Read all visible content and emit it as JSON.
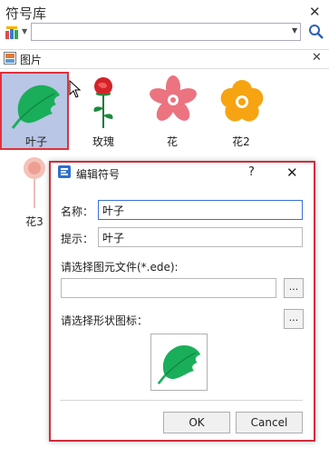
{
  "panel": {
    "title": "符号库",
    "close_glyph": "✕"
  },
  "toolbar": {
    "category_icon": "library-icon",
    "combo_value": "",
    "search_icon": "search-icon"
  },
  "tab": {
    "label": "图片",
    "close_glyph": "✕"
  },
  "symbols": [
    {
      "label": "叶子",
      "selected": true
    },
    {
      "label": "玫瑰",
      "selected": false
    },
    {
      "label": "花",
      "selected": false
    },
    {
      "label": "花2",
      "selected": false
    },
    {
      "label": "花3",
      "selected": false
    }
  ],
  "dialog": {
    "title": "编辑符号",
    "help_glyph": "?",
    "close_glyph": "✕",
    "name_label": "名称：",
    "name_value": "叶子",
    "hint_label": "提示：",
    "hint_value": "叶子",
    "file_label": "请选择图元文件(*.ede):",
    "file_value": "",
    "browse_label": "...",
    "icon_label": "请选择形状图标：",
    "ok_label": "OK",
    "cancel_label": "Cancel"
  },
  "colors": {
    "selection_bg": "#b9c6e6",
    "highlight_red": "#e0323c",
    "leaf_green": "#1aae5a",
    "flower_pink": "#ec7380",
    "flower_orange": "#f6a412",
    "rose_red": "#d2232a",
    "accent_blue": "#3a6fd8"
  }
}
